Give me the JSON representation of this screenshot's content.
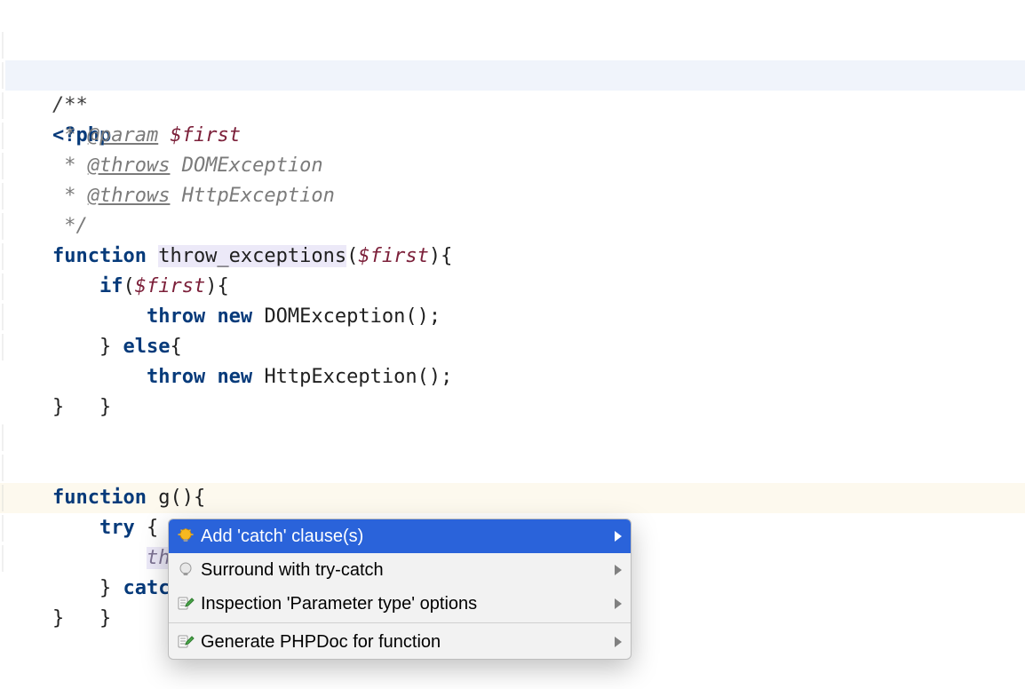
{
  "php_open": "<?php",
  "docblock": {
    "open": "/**",
    "star": " * ",
    "param_tag": "@param",
    "param_var": "$first",
    "throws_tag": "@throws",
    "throws1_type": "DOMException",
    "throws2_type": "HttpException",
    "close": " */"
  },
  "fn1": {
    "kw_function": "function",
    "name": "throw_exceptions",
    "open_paren": "(",
    "param": "$first",
    "close_paren_brace": "){",
    "if_kw": "if",
    "if_open": "(",
    "if_var": "$first",
    "if_close": "){",
    "throw_kw": "throw",
    "new_kw": "new",
    "dom": "DOMException();",
    "else_line": "} ",
    "else_kw": "else",
    "else_brace": "{",
    "http": "HttpException();",
    "rbrace": "}"
  },
  "fn2": {
    "kw_function": "function",
    "name": "g",
    "parens_brace": "(){",
    "try_kw": "try",
    "try_brace": " {",
    "call_name": "throw_exceptions",
    "call_lparen": "(",
    "call_rparen": ")",
    "call_semi": ";",
    "catch_prefix": "} ",
    "catch_kw": "catch",
    "catch_open": " (",
    "rbrace": "}"
  },
  "close_brace": "}",
  "popup": {
    "items": [
      {
        "label": "Add 'catch' clause(s)",
        "icon": "bulb-lit"
      },
      {
        "label": "Surround with try-catch",
        "icon": "bulb-dim"
      },
      {
        "label": "Inspection 'Parameter type' options",
        "icon": "pencil"
      },
      {
        "label": "Generate PHPDoc for function",
        "icon": "pencil"
      }
    ]
  }
}
